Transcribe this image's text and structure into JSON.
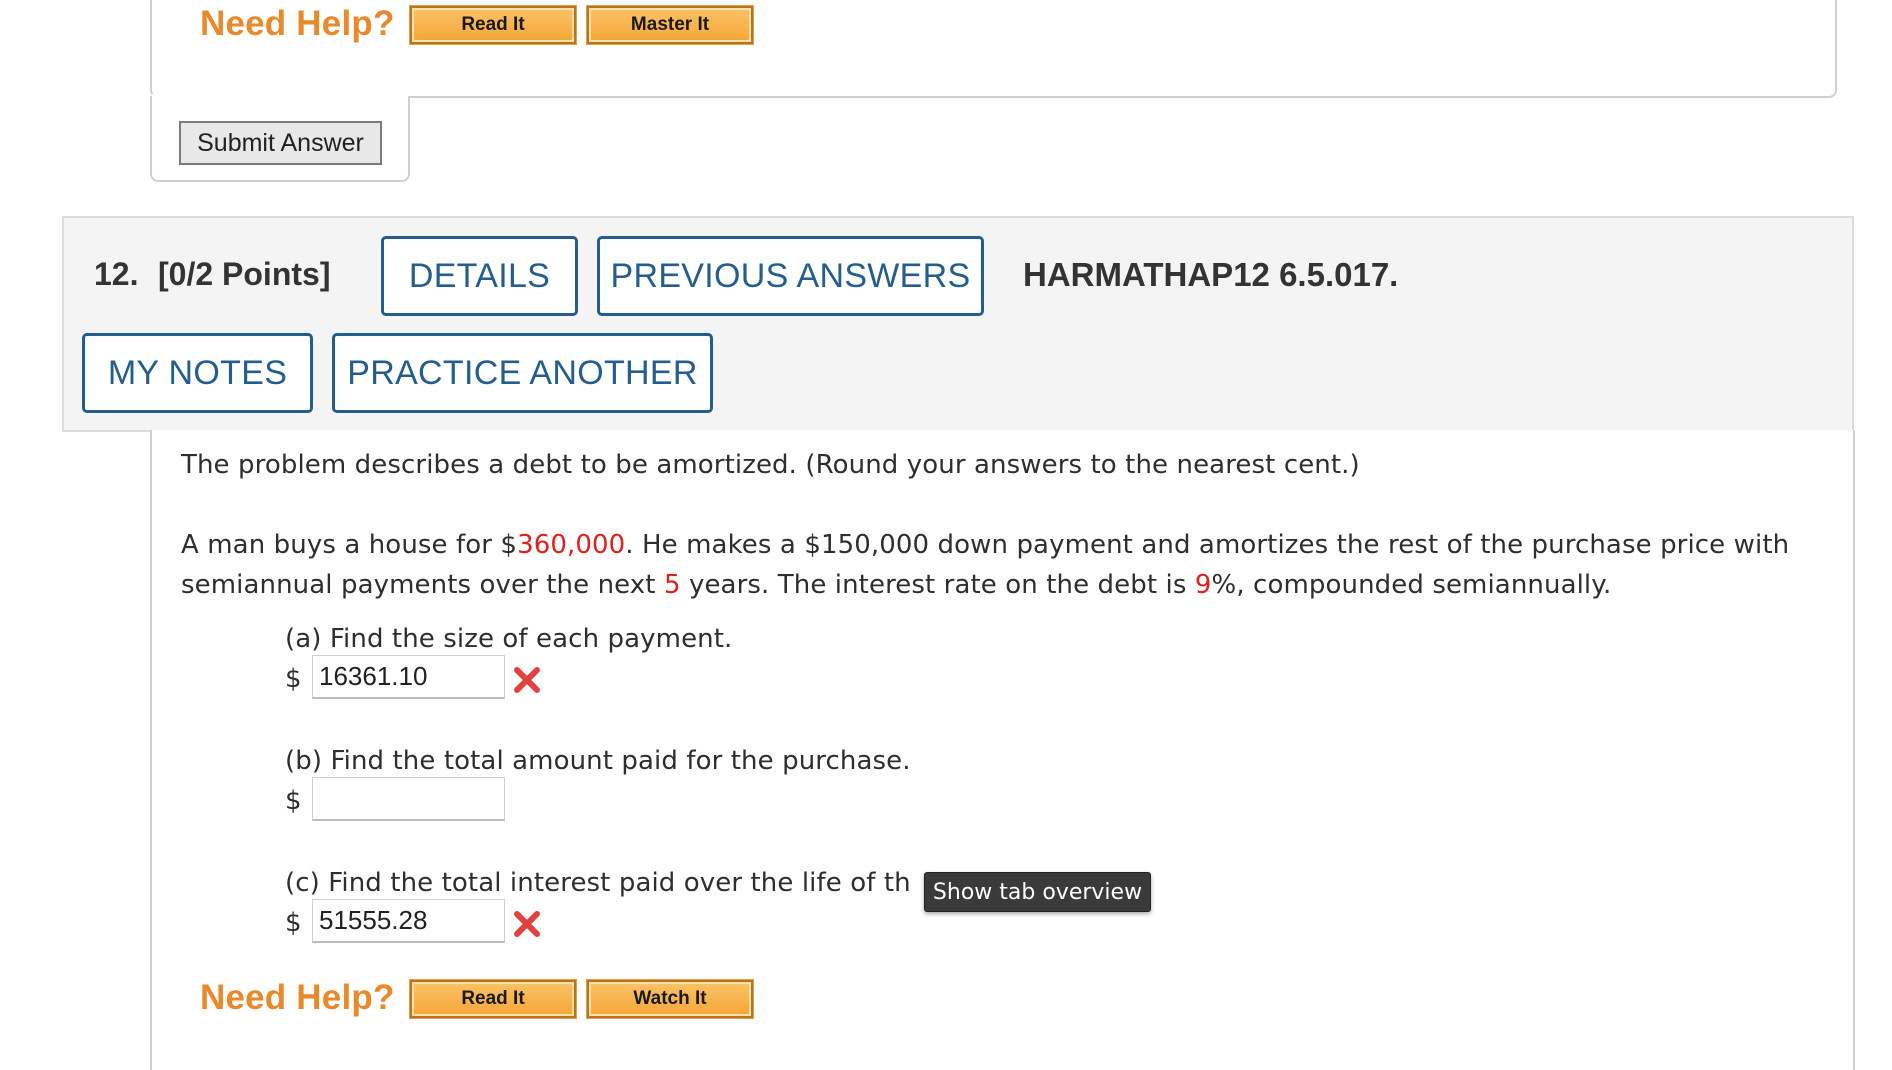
{
  "previous_question": {
    "need_help": "Need Help?",
    "read_it": "Read It",
    "master_it": "Master It",
    "submit": "Submit Answer"
  },
  "question": {
    "number": "12.",
    "points": "[0/2 Points]",
    "details": "DETAILS",
    "previous_answers": "PREVIOUS ANSWERS",
    "id": "HARMATHAP12 6.5.017.",
    "my_notes": "MY NOTES",
    "practice_another": "PRACTICE ANOTHER",
    "instructions": "The problem describes a debt to be amortized. (Round your answers to the nearest cent.)",
    "problem": {
      "p1": "A man buys a house for $",
      "price": "360,000",
      "p2": ". He makes a $150,000 down payment and amortizes the rest of the purchase price with",
      "p3": "semiannual payments over the next ",
      "years": "5",
      "p4": " years. The interest rate on the debt is ",
      "rate": "9",
      "p5": "%, compounded semiannually."
    },
    "parts": [
      {
        "label": "(a) Find the size of each payment.",
        "currency": "$",
        "value": "16361.10",
        "status": "incorrect"
      },
      {
        "label": "(b) Find the total amount paid for the purchase.",
        "currency": "$",
        "value": "",
        "status": "unanswered"
      },
      {
        "label": "(c) Find the total interest paid over the life of th",
        "currency": "$",
        "value": "51555.28",
        "status": "incorrect"
      }
    ],
    "need_help": "Need Help?",
    "read_it": "Read It",
    "watch_it": "Watch It"
  },
  "tooltip": "Show tab overview",
  "colors": {
    "accent": "#255e8e",
    "help": "#e8892b",
    "highlight": "#e0201b",
    "error": "#e0433f"
  }
}
